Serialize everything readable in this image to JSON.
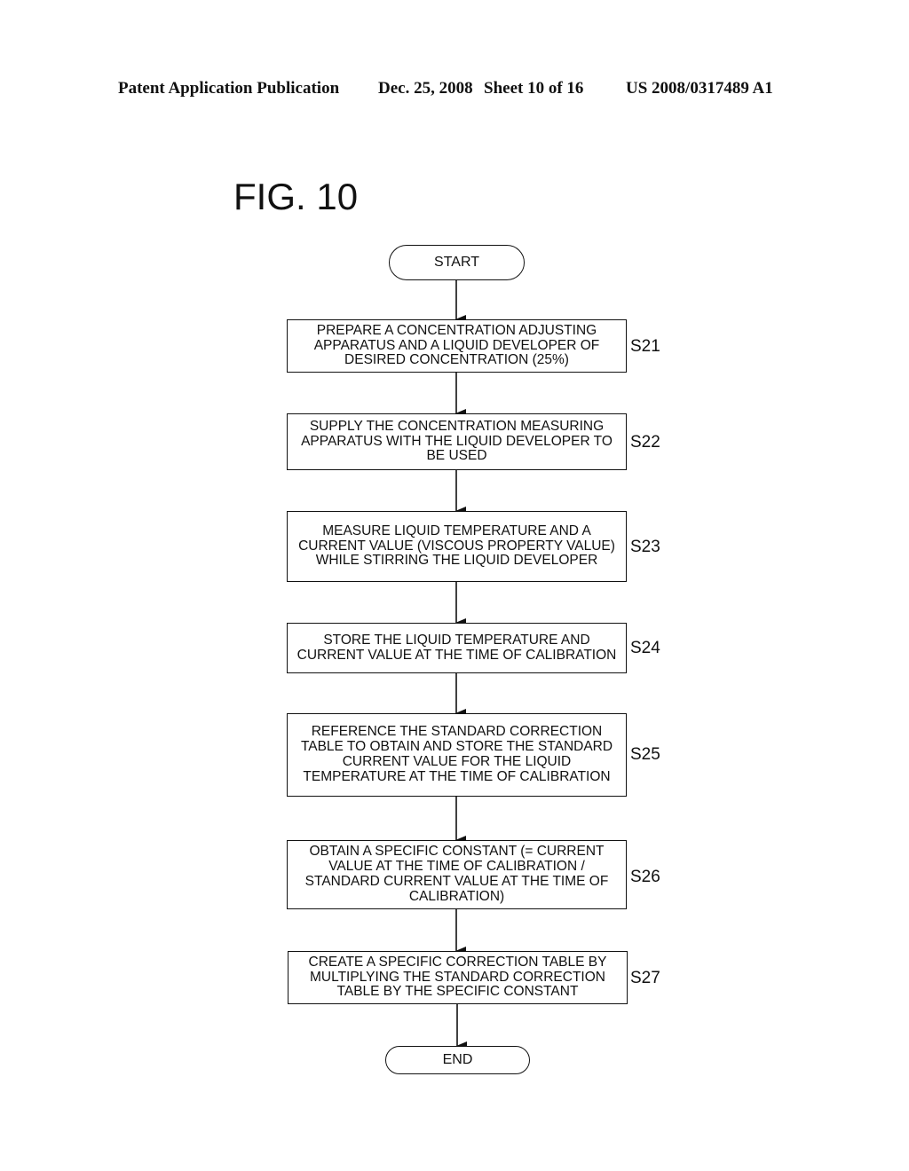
{
  "header": {
    "publication": "Patent Application Publication",
    "date": "Dec. 25, 2008",
    "sheet": "Sheet 10 of 16",
    "number": "US 2008/0317489 A1"
  },
  "figure": {
    "title": "FIG. 10",
    "start": "START",
    "end": "END",
    "steps": [
      {
        "id": "S21",
        "text": "PREPARE A CONCENTRATION ADJUSTING APPARATUS AND A LIQUID DEVELOPER OF DESIRED CONCENTRATION (25%)"
      },
      {
        "id": "S22",
        "text": "SUPPLY THE CONCENTRATION MEASURING APPARATUS WITH THE LIQUID DEVELOPER TO BE USED"
      },
      {
        "id": "S23",
        "text": "MEASURE LIQUID TEMPERATURE AND A CURRENT VALUE (VISCOUS PROPERTY VALUE) WHILE STIRRING THE LIQUID DEVELOPER"
      },
      {
        "id": "S24",
        "text": "STORE THE LIQUID TEMPERATURE AND CURRENT VALUE AT THE TIME OF CALIBRATION"
      },
      {
        "id": "S25",
        "text": "REFERENCE THE STANDARD CORRECTION TABLE TO OBTAIN AND STORE THE STANDARD CURRENT VALUE FOR THE LIQUID TEMPERATURE AT THE TIME OF CALIBRATION"
      },
      {
        "id": "S26",
        "text": "OBTAIN A SPECIFIC CONSTANT (= CURRENT VALUE AT THE TIME OF CALIBRATION / STANDARD CURRENT VALUE AT THE TIME OF CALIBRATION)"
      },
      {
        "id": "S27",
        "text": "CREATE A SPECIFIC CORRECTION TABLE BY MULTIPLYING THE STANDARD CORRECTION TABLE BY THE SPECIFIC CONSTANT"
      }
    ]
  }
}
